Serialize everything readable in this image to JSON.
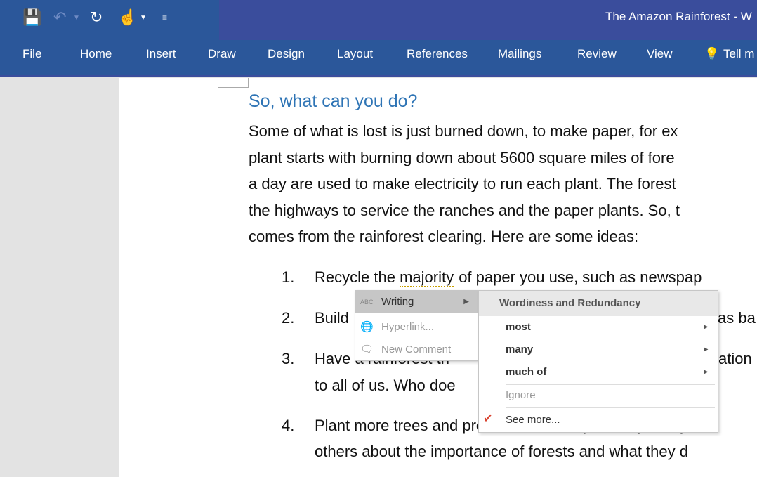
{
  "window": {
    "title": "The Amazon Rainforest - W"
  },
  "quick_access": {
    "save": "save-icon",
    "undo": "undo-icon",
    "redo": "repeat-icon",
    "touch": "touch-mode-icon",
    "customize": "customize-icon"
  },
  "tabs": [
    "File",
    "Home",
    "Insert",
    "Draw",
    "Design",
    "Layout",
    "References",
    "Mailings",
    "Review",
    "View",
    "Tell m"
  ],
  "document": {
    "heading": "So, what can you do?",
    "paragraph": [
      "Some of what is lost is just burned down, to make paper, for ex",
      "plant starts with burning down about 5600 square miles of fore",
      "a day are used to make electricity to run each plant. The forest",
      "the highways to service the ranches and the paper plants. So, t",
      "comes from the rainforest clearing. Here are some ideas:"
    ],
    "list": [
      {
        "num": "1.",
        "lines": [
          "Recycle the ",
          "majority",
          " of paper you use, such as newspap"
        ]
      },
      {
        "num": "2.",
        "lines": [
          "Build",
          "as ba"
        ]
      },
      {
        "num": "3.",
        "lines": [
          "Have a rainforest th",
          "ation",
          "to all of us. Who doe"
        ]
      },
      {
        "num": "4.",
        "lines": [
          "Plant more trees and protect them. They will improve y",
          "others about the importance of forests and what they d"
        ]
      }
    ]
  },
  "context_menu": {
    "items": [
      {
        "label": "Writing"
      },
      {
        "label": "Hyperlink..."
      },
      {
        "label": "New Comment"
      }
    ]
  },
  "submenu": {
    "header": "Wordiness and Redundancy",
    "suggestions": [
      "most",
      "many",
      "much of"
    ],
    "ignore": "Ignore",
    "see_more": "See more..."
  }
}
